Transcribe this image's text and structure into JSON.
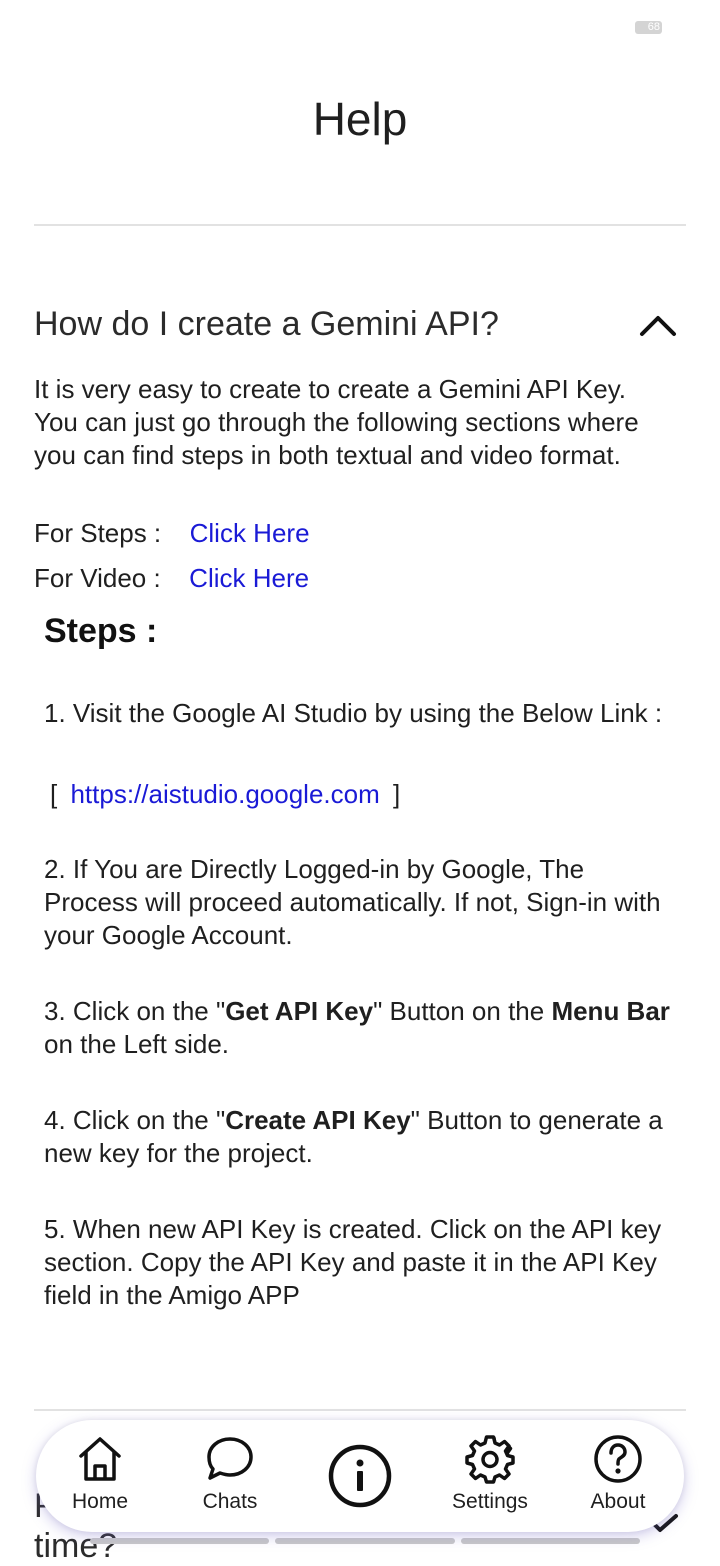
{
  "status_bar": {
    "battery": "68"
  },
  "page": {
    "title": "Help"
  },
  "faq": {
    "question": "How do I create a Gemini API?",
    "answer": "It is very easy to create to create a Gemini API Key. You can just go through the following sections where you can find steps in both textual and video format.",
    "steps_link": {
      "label": "For Steps :",
      "link_text": "Click Here"
    },
    "video_link": {
      "label": "For Video :",
      "link_text": "Click Here"
    },
    "steps_title": "Steps :",
    "step1": {
      "text": "1. Visit the Google AI Studio by using the Below Link :",
      "bracket_open": "[",
      "url": "https://aistudio.google.com",
      "bracket_close": "]"
    },
    "step2": {
      "text": "2. If You are Directly Logged-in by Google, The Process will proceed automatically. If not, Sign-in with your Google Account."
    },
    "step3": {
      "prefix": "3. Click on the \"",
      "bold1": "Get API Key",
      "middle": "\" Button on the ",
      "bold2": "Menu Bar",
      "suffix": " on the Left side."
    },
    "step4": {
      "prefix": "4. Click on the \"",
      "bold": "Create API Key",
      "suffix": "\" Button to generate a new key for the project."
    },
    "step5": {
      "text": "5. When new API Key is created. Click on the API key section. Copy the API Key and paste it in the API Key field in the Amigo APP"
    }
  },
  "next_faq_partial": {
    "line1": "F",
    "line2": "time?"
  },
  "bottom_nav": {
    "home": "Home",
    "chats": "Chats",
    "center_icon": "info-icon",
    "settings": "Settings",
    "about": "About"
  }
}
